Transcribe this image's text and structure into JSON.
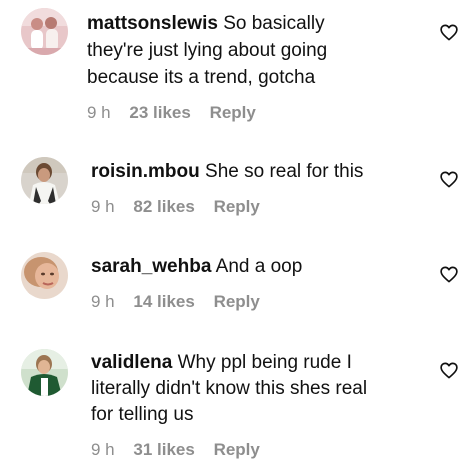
{
  "comments": [
    {
      "username": "mattsonslewis",
      "lines": [
        "So basically",
        "they're just lying about going",
        "because its a trend, gotcha"
      ],
      "time": "9 h",
      "likes": "23 likes",
      "reply": "Reply"
    },
    {
      "username": "roisin.mbou",
      "lines": [
        "She so real for this"
      ],
      "time": "9 h",
      "likes": "82 likes",
      "reply": "Reply"
    },
    {
      "username": "sarah_wehba",
      "lines": [
        "And a oop"
      ],
      "time": "9 h",
      "likes": "14 likes",
      "reply": "Reply"
    },
    {
      "username": "validlena",
      "lines": [
        "Why ppl being rude I",
        "literally didn't know this shes real",
        "for telling us"
      ],
      "time": "9 h",
      "likes": "31 likes",
      "reply": "Reply"
    }
  ],
  "icons": {
    "like": "heart-outline-icon"
  }
}
